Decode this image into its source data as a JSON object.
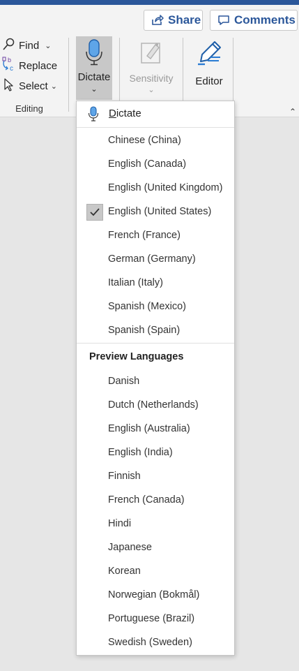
{
  "header": {
    "share_label": "Share",
    "comments_label": "Comments"
  },
  "editing_group": {
    "find_label": "Find",
    "replace_label": "Replace",
    "select_label": "Select",
    "group_label": "Editing"
  },
  "ribbon": {
    "dictate_label": "Dictate",
    "sensitivity_label": "Sensitivity",
    "editor_label": "Editor"
  },
  "menu": {
    "head_access_key": "D",
    "head_rest": "ictate",
    "languages": [
      {
        "label": "Chinese (China)",
        "selected": false
      },
      {
        "label": "English (Canada)",
        "selected": false
      },
      {
        "label": "English (United Kingdom)",
        "selected": false
      },
      {
        "label": "English (United States)",
        "selected": true
      },
      {
        "label": "French (France)",
        "selected": false
      },
      {
        "label": "German (Germany)",
        "selected": false
      },
      {
        "label": "Italian (Italy)",
        "selected": false
      },
      {
        "label": "Spanish (Mexico)",
        "selected": false
      },
      {
        "label": "Spanish (Spain)",
        "selected": false
      }
    ],
    "preview_title": "Preview Languages",
    "preview_languages": [
      "Danish",
      "Dutch (Netherlands)",
      "English (Australia)",
      "English (India)",
      "Finnish",
      "French (Canada)",
      "Hindi",
      "Japanese",
      "Korean",
      "Norwegian (Bokmål)",
      "Portuguese (Brazil)",
      "Swedish (Sweden)"
    ]
  },
  "colors": {
    "accent": "#2b579a",
    "mic_blue": "#2b7cd3",
    "ribbon_bg": "#f3f3f3",
    "pressed_bg": "#c8c8c8"
  }
}
